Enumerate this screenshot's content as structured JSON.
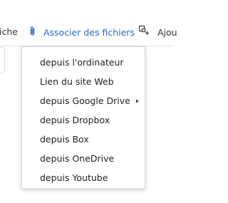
{
  "toolbar": {
    "left_partial_label": "iche",
    "attach_label": "Associer des fichiers",
    "add_partial_label": "Ajou",
    "accent_color": "#2a68c8"
  },
  "menu": {
    "items": [
      {
        "label": "depuis l'ordinateur",
        "has_submenu": false
      },
      {
        "label": "Lien du site Web",
        "has_submenu": false
      },
      {
        "label": "depuis Google Drive",
        "has_submenu": true
      },
      {
        "label": "depuis Dropbox",
        "has_submenu": false
      },
      {
        "label": "depuis Box",
        "has_submenu": false
      },
      {
        "label": "depuis OneDrive",
        "has_submenu": false
      },
      {
        "label": "depuis Youtube",
        "has_submenu": false
      }
    ]
  },
  "icons": {
    "attach": "paperclip-icon",
    "add": "add-block-icon",
    "submenu": "caret-right-icon"
  }
}
